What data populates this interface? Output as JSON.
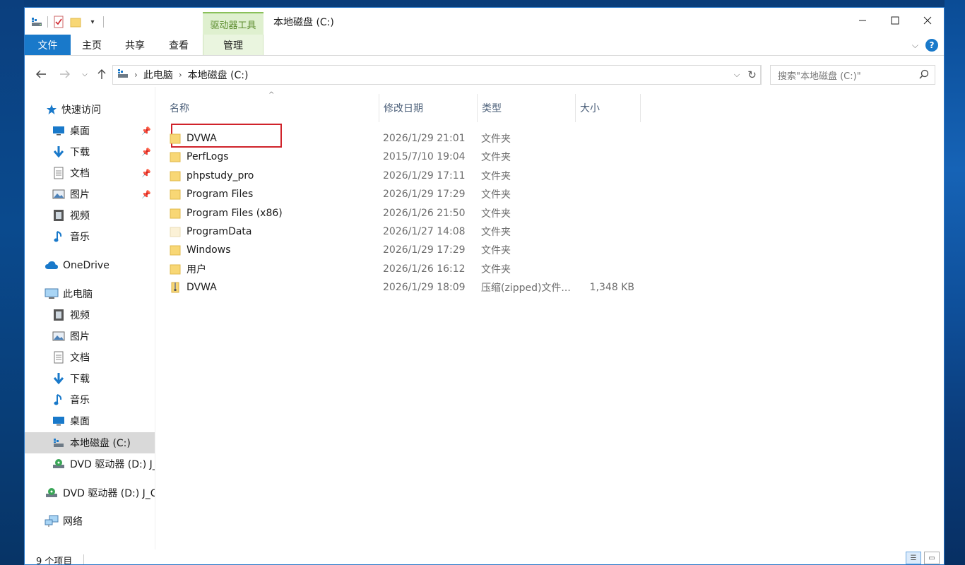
{
  "window": {
    "title": "本地磁盘 (C:)",
    "context_tab_group": "驱动器工具"
  },
  "ribbon": {
    "tabs": [
      {
        "label": "文件"
      },
      {
        "label": "主页"
      },
      {
        "label": "共享"
      },
      {
        "label": "查看"
      },
      {
        "label": "管理"
      }
    ],
    "help": "?"
  },
  "address": {
    "crumbs": [
      "此电脑",
      "本地磁盘 (C:)"
    ],
    "search_placeholder": "搜索\"本地磁盘 (C:)\""
  },
  "nav": {
    "quick_access": "快速访问",
    "quick_items": [
      {
        "label": "桌面",
        "icon": "desktop-icon",
        "pinned": true
      },
      {
        "label": "下载",
        "icon": "download-icon",
        "pinned": true
      },
      {
        "label": "文档",
        "icon": "document-icon",
        "pinned": true
      },
      {
        "label": "图片",
        "icon": "picture-icon",
        "pinned": true
      },
      {
        "label": "视频",
        "icon": "video-icon",
        "pinned": false
      },
      {
        "label": "音乐",
        "icon": "music-icon",
        "pinned": false
      }
    ],
    "onedrive": "OneDrive",
    "this_pc": "此电脑",
    "pc_items": [
      {
        "label": "视频",
        "icon": "video-icon"
      },
      {
        "label": "图片",
        "icon": "picture-icon"
      },
      {
        "label": "文档",
        "icon": "document-icon"
      },
      {
        "label": "下载",
        "icon": "download-icon"
      },
      {
        "label": "音乐",
        "icon": "music-icon"
      },
      {
        "label": "桌面",
        "icon": "desktop-icon"
      },
      {
        "label": "本地磁盘 (C:)",
        "icon": "drive-icon",
        "selected": true
      },
      {
        "label": "DVD 驱动器 (D:) J_",
        "icon": "dvd-icon"
      }
    ],
    "dvd_root": "DVD 驱动器 (D:) J_C",
    "network": "网络"
  },
  "columns": {
    "name": "名称",
    "date": "修改日期",
    "type": "类型",
    "size": "大小"
  },
  "files": [
    {
      "name": "DVWA",
      "date": "2026/1/29 21:01",
      "type": "文件夹",
      "size": "",
      "kind": "folder"
    },
    {
      "name": "PerfLogs",
      "date": "2015/7/10 19:04",
      "type": "文件夹",
      "size": "",
      "kind": "folder"
    },
    {
      "name": "phpstudy_pro",
      "date": "2026/1/29 17:11",
      "type": "文件夹",
      "size": "",
      "kind": "folder"
    },
    {
      "name": "Program Files",
      "date": "2026/1/29 17:29",
      "type": "文件夹",
      "size": "",
      "kind": "folder"
    },
    {
      "name": "Program Files (x86)",
      "date": "2026/1/26 21:50",
      "type": "文件夹",
      "size": "",
      "kind": "folder"
    },
    {
      "name": "ProgramData",
      "date": "2026/1/27 14:08",
      "type": "文件夹",
      "size": "",
      "kind": "hidden-folder"
    },
    {
      "name": "Windows",
      "date": "2026/1/29 17:29",
      "type": "文件夹",
      "size": "",
      "kind": "folder"
    },
    {
      "name": "用户",
      "date": "2026/1/26 16:12",
      "type": "文件夹",
      "size": "",
      "kind": "folder"
    },
    {
      "name": "DVWA",
      "date": "2026/1/29 18:09",
      "type": "压缩(zipped)文件...",
      "size": "1,348 KB",
      "kind": "zip"
    }
  ],
  "status": {
    "count": "9 个项目"
  },
  "colors": {
    "accent": "#1979ca",
    "context_tab": "#dff0cf",
    "highlight": "#d0232b",
    "folder": "#f8d775"
  }
}
